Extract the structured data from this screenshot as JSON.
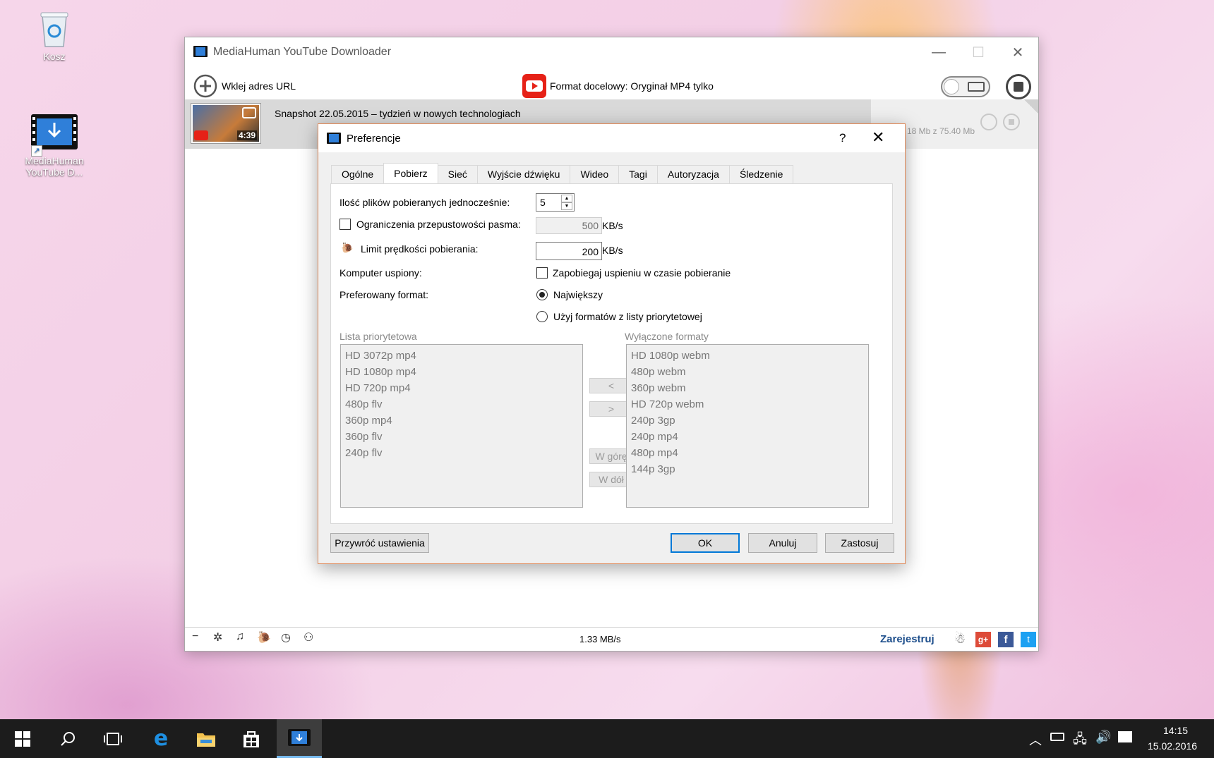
{
  "desktop": {
    "recycle_label": "Kosz",
    "shortcut_label_1": "MediaHuman",
    "shortcut_label_2": "YouTube D..."
  },
  "main_window": {
    "title": "MediaHuman YouTube Downloader",
    "paste_url_label": "Wklej adres URL",
    "format_label": "Format docelowy: Oryginał MP4 tylko",
    "download": {
      "title": "Snapshot 22.05.2015 – tydzień w nowych technologiach",
      "duration": "4:39",
      "size": "18 Mb z 75.40 Mb"
    },
    "status": {
      "speed": "1.33 MB/s",
      "register": "Zarejestruj"
    }
  },
  "dialog": {
    "title": "Preferencje",
    "help": "?",
    "tabs": [
      "Ogólne",
      "Pobierz",
      "Sieć",
      "Wyjście dźwięku",
      "Wideo",
      "Tagi",
      "Autoryzacja",
      "Śledzenie"
    ],
    "active_tab": "Pobierz",
    "simultaneous_label": "Ilość plików pobieranych jednocześnie:",
    "simultaneous_value": "5",
    "bandwidth_label": "Ograniczenia przepustowości pasma:",
    "bandwidth_value": "500",
    "bandwidth_unit": "KB/s",
    "speed_limit_label": "Limit prędkości pobierania:",
    "speed_limit_value": "200",
    "speed_limit_unit": "KB/s",
    "sleep_label": "Komputer uspiony:",
    "sleep_option": "Zapobiegaj uspieniu w czasie pobieranie",
    "format_label": "Preferowany format:",
    "format_opt_largest": "Największy",
    "format_opt_priority": "Użyj formatów z listy priorytetowej",
    "priority_list_label": "Lista priorytetowa",
    "priority_list": [
      "HD 3072p mp4",
      "HD 1080p mp4",
      "HD 720p mp4",
      "480p flv",
      "360p mp4",
      "360p flv",
      "240p flv"
    ],
    "disabled_list_label": "Wyłączone formaty",
    "disabled_list": [
      "HD 1080p webm",
      "480p webm",
      "360p webm",
      "HD 720p webm",
      "240p 3gp",
      "240p mp4",
      "480p mp4",
      "144p 3gp"
    ],
    "move_left": "<",
    "move_right": ">",
    "move_up": "W górę",
    "move_down": "W dół",
    "restore": "Przywróć ustawienia",
    "ok": "OK",
    "cancel": "Anuluj",
    "apply": "Zastosuj"
  },
  "taskbar": {
    "time": "14:15",
    "date": "15.02.2016"
  },
  "colors": {
    "accent": "#0078d7",
    "youtube_red": "#e62117",
    "dialog_border": "#e08a5a",
    "register": "#1e4f8c"
  }
}
